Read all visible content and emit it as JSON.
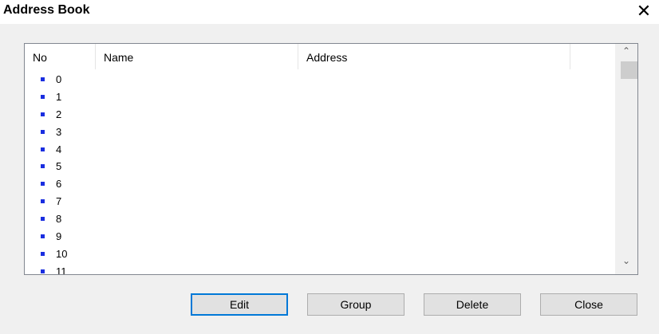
{
  "window": {
    "title": "Address Book",
    "close_glyph": "✕"
  },
  "list": {
    "columns": [
      "No",
      "Name",
      "Address",
      ""
    ],
    "rows": [
      "0",
      "1",
      "2",
      "3",
      "4",
      "5",
      "6",
      "7",
      "8",
      "9",
      "10",
      "11"
    ],
    "bullet_color": "#1a2ee0"
  },
  "scrollbar": {
    "up_glyph": "⌃",
    "down_glyph": "⌄"
  },
  "buttons": {
    "edit": "Edit",
    "group": "Group",
    "delete": "Delete",
    "close": "Close"
  }
}
